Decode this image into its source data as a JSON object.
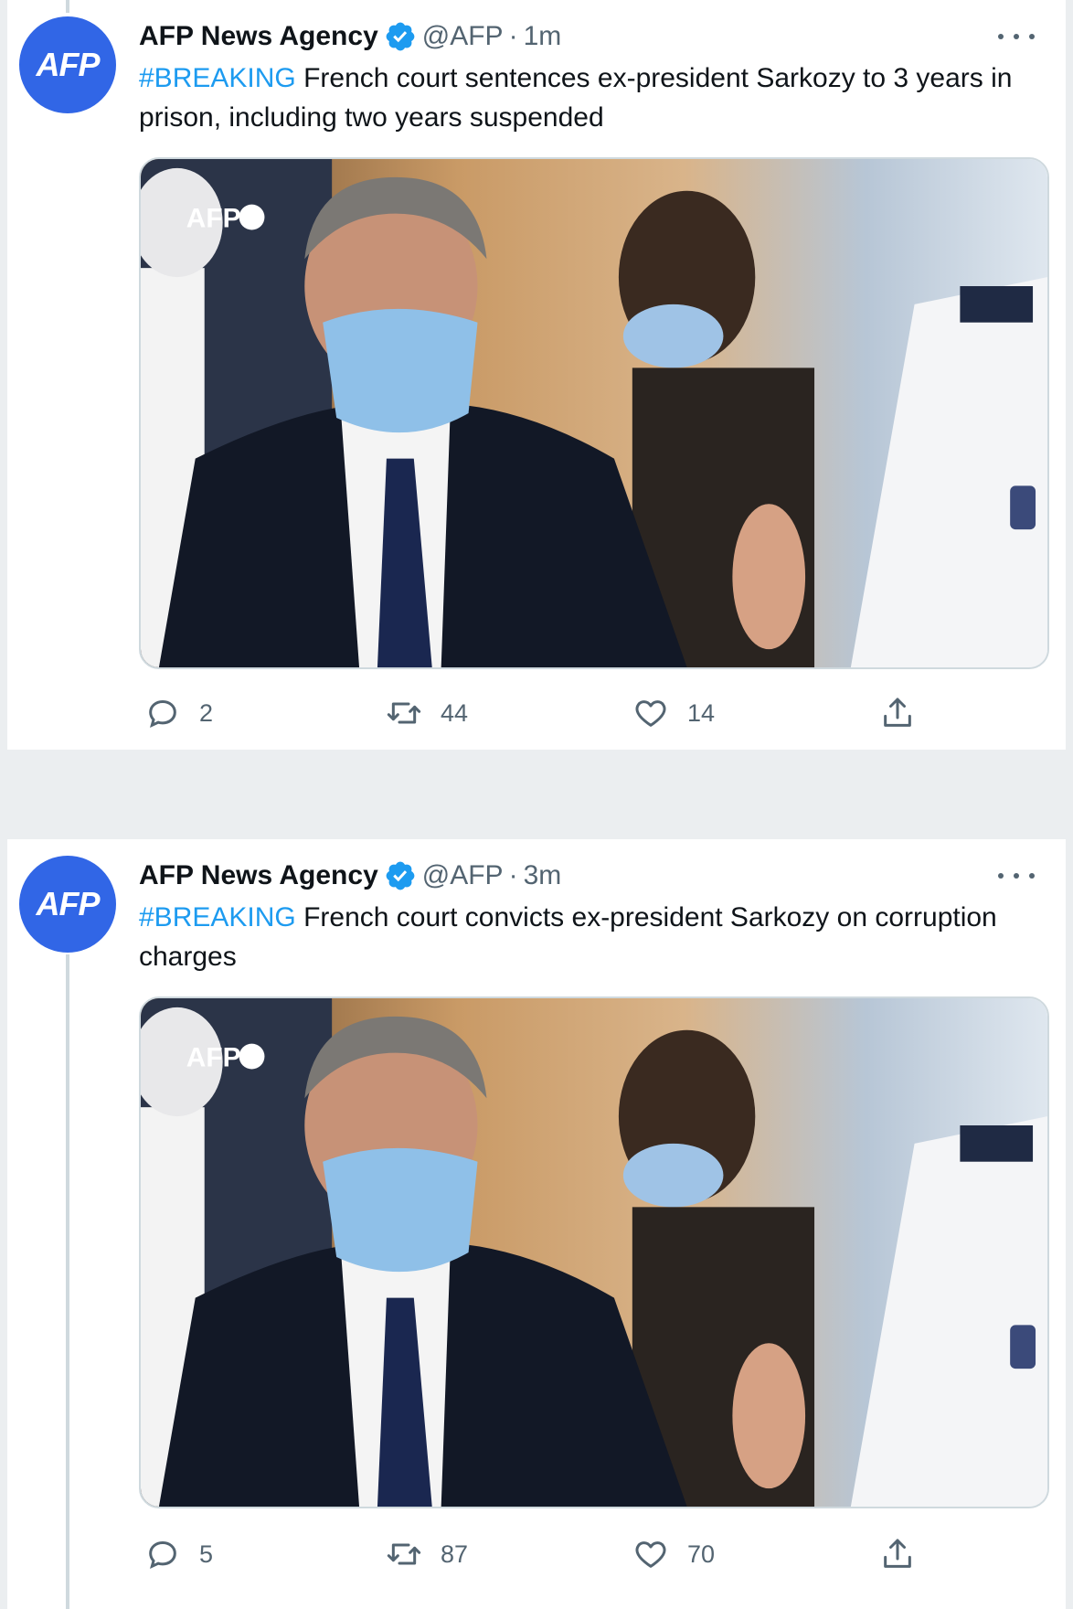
{
  "colors": {
    "accent": "#1d9bf0",
    "avatar_bg": "#3166e6",
    "muted": "#536471",
    "background": "#ebeef0"
  },
  "tweets": [
    {
      "avatar_text": "AFP",
      "name": "AFP News Agency",
      "handle": "@AFP",
      "separator": "·",
      "time": "1m",
      "hashtag": "#BREAKING",
      "text": " French court sentences ex-president Sarkozy to 3 years in prison, including two years suspended",
      "media_watermark": "AFP",
      "reply_count": "2",
      "retweet_count": "44",
      "like_count": "14"
    },
    {
      "avatar_text": "AFP",
      "name": "AFP News Agency",
      "handle": "@AFP",
      "separator": "·",
      "time": "3m",
      "hashtag": "#BREAKING",
      "text": " French court convicts ex-president Sarkozy on corruption charges",
      "media_watermark": "AFP",
      "reply_count": "5",
      "retweet_count": "87",
      "like_count": "70"
    }
  ],
  "icons": {
    "verified": "verified-badge-icon",
    "more": "more-dots-icon",
    "reply": "reply-icon",
    "retweet": "retweet-icon",
    "like": "heart-icon",
    "share": "share-icon"
  }
}
